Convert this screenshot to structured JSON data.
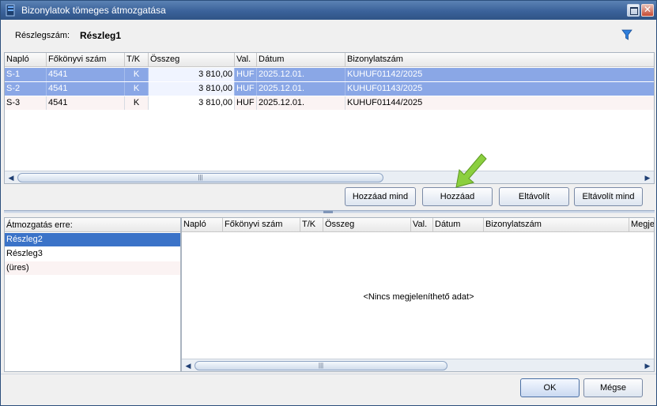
{
  "window": {
    "title": "Bizonylatok tömeges átmozgatása"
  },
  "header": {
    "reszleg_label": "Részlegszám:",
    "reszleg_value": "Részleg1"
  },
  "source_grid": {
    "columns": [
      "Napló",
      "Főkönyvi szám",
      "T/K",
      "Összeg",
      "Val.",
      "Dátum",
      "Bizonylatszám"
    ],
    "rows": [
      [
        "S-1",
        "4541",
        "K",
        "3 810,00",
        "HUF",
        "2025.12.01.",
        "KUHUF01142/2025"
      ],
      [
        "S-2",
        "4541",
        "K",
        "3 810,00",
        "HUF",
        "2025.12.01.",
        "KUHUF01143/2025"
      ],
      [
        "S-3",
        "4541",
        "K",
        "3 810,00",
        "HUF",
        "2025.12.01.",
        "KUHUF01144/2025"
      ]
    ]
  },
  "actions": {
    "add_all": "Hozzáad mind",
    "add": "Hozzáad",
    "remove": "Eltávolít",
    "remove_all": "Eltávolít mind"
  },
  "target_list": {
    "header": "Átmozgatás erre:",
    "items": [
      "Részleg2",
      "Részleg3",
      "(üres)"
    ]
  },
  "dest_grid": {
    "columns": [
      "Napló",
      "Főkönyvi szám",
      "T/K",
      "Összeg",
      "Val.",
      "Dátum",
      "Bizonylatszám",
      "Megje"
    ],
    "empty_message": "<Nincs megjeleníthető adat>"
  },
  "footer": {
    "ok": "OK",
    "cancel": "Mégse"
  },
  "colors": {
    "selection": "#8aa7e6",
    "list_selection": "#3b73c8",
    "title_bar": "#3b629a"
  },
  "icons": {
    "app": "app-icon",
    "filter": "filter-icon",
    "maximize": "maximize-icon",
    "close": "close-icon"
  }
}
